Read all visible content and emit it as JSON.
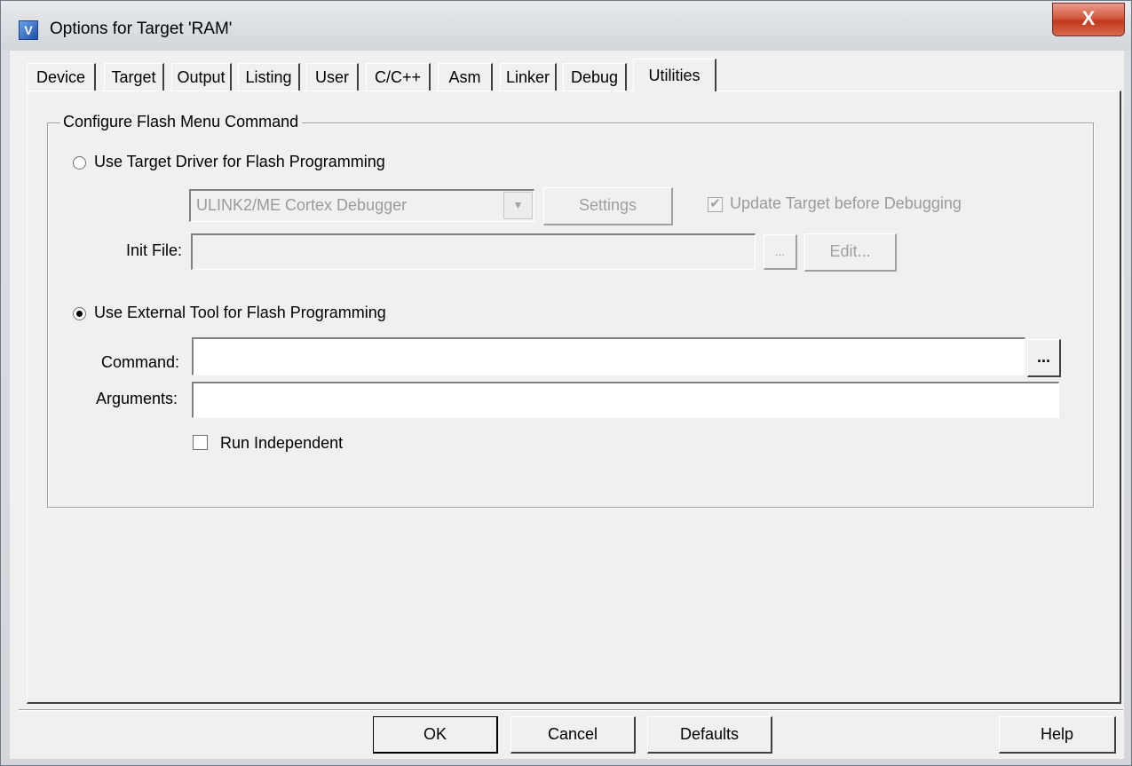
{
  "window": {
    "title": "Options for Target 'RAM'",
    "close_glyph": "X"
  },
  "tabs": [
    {
      "label": "Device"
    },
    {
      "label": "Target"
    },
    {
      "label": "Output"
    },
    {
      "label": "Listing"
    },
    {
      "label": "User"
    },
    {
      "label": "C/C++"
    },
    {
      "label": "Asm"
    },
    {
      "label": "Linker"
    },
    {
      "label": "Debug"
    },
    {
      "label": "Utilities",
      "active": true
    }
  ],
  "flash_group": {
    "title": "Configure Flash Menu Command",
    "target_driver_label": "Use Target Driver for Flash Programming",
    "target_driver_selected": false,
    "driver_value": "ULINK2/ME Cortex Debugger",
    "settings_label": "Settings",
    "update_target_label": "Update Target before Debugging",
    "update_target_checked": true,
    "init_file_label": "Init File:",
    "init_file_value": "",
    "browse_label": "...",
    "edit_label": "Edit...",
    "external_tool_label": "Use External Tool for Flash Programming",
    "external_tool_selected": true,
    "command_label": "Command:",
    "command_value": "",
    "command_browse_label": "...",
    "arguments_label": "Arguments:",
    "arguments_value": "",
    "run_independent_label": "Run Independent",
    "run_independent_checked": false
  },
  "footer": {
    "ok_label": "OK",
    "cancel_label": "Cancel",
    "defaults_label": "Defaults",
    "help_label": "Help"
  }
}
